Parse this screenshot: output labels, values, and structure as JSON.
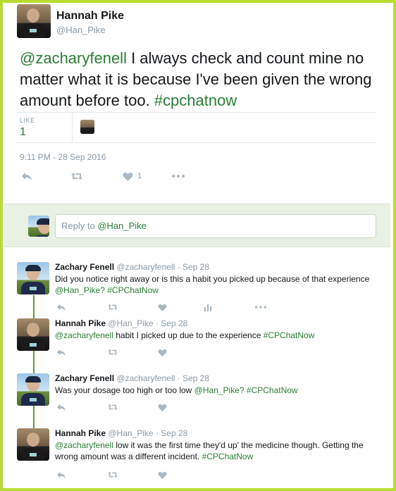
{
  "main_tweet": {
    "name": "Hannah Pike",
    "handle": "@Han_Pike",
    "text_mention": "@zacharyfenell",
    "text_body": " I always check and count mine no matter what it is because I've been given the wrong amount before too. ",
    "text_hashtag": "#cpchatnow",
    "likes_label": "LIKE",
    "likes_count": "1",
    "timestamp": "9:11 PM - 28 Sep 2016",
    "like_action_count": "1"
  },
  "reply_box": {
    "prefix": "Reply to ",
    "mention": "@Han_Pike"
  },
  "thread": [
    {
      "name": "Zachary Fenell",
      "handle": "@zacharyfenell",
      "time": "· Sep 28",
      "text": "Did you notice right away or is this a habit you picked up because of that experience",
      "mention": "@Han_Pike",
      "hashtag": "? #CPChatNow"
    },
    {
      "name": "Hannah Pike",
      "handle": "@Han_Pike",
      "time": "· Sep 28",
      "mention": "@zacharyfenell",
      "text": " habit I picked up due to the experience ",
      "hashtag": "#CPChatNow"
    },
    {
      "name": "Zachary Fenell",
      "handle": "@zacharyfenell",
      "time": "· Sep 28",
      "text": "Was your dosage too high or too low ",
      "mention": "@Han_Pike",
      "hashtag": "? #CPChatNow"
    },
    {
      "name": "Hannah Pike",
      "handle": "@Han_Pike",
      "time": "· Sep 28",
      "mention": "@zacharyfenell",
      "text": " low it was the first time they'd up' the medicine though. Getting the wrong amount was a different incident. ",
      "hashtag": "#CPChatNow"
    }
  ],
  "colors": {
    "frame": "#b9dd2e",
    "link": "#2a7d35",
    "reply_area": "#e8f1e4",
    "icon": "#aab8c2"
  },
  "icons": [
    "reply-icon",
    "retweet-icon",
    "heart-icon",
    "more-icon",
    "analytics-icon"
  ]
}
